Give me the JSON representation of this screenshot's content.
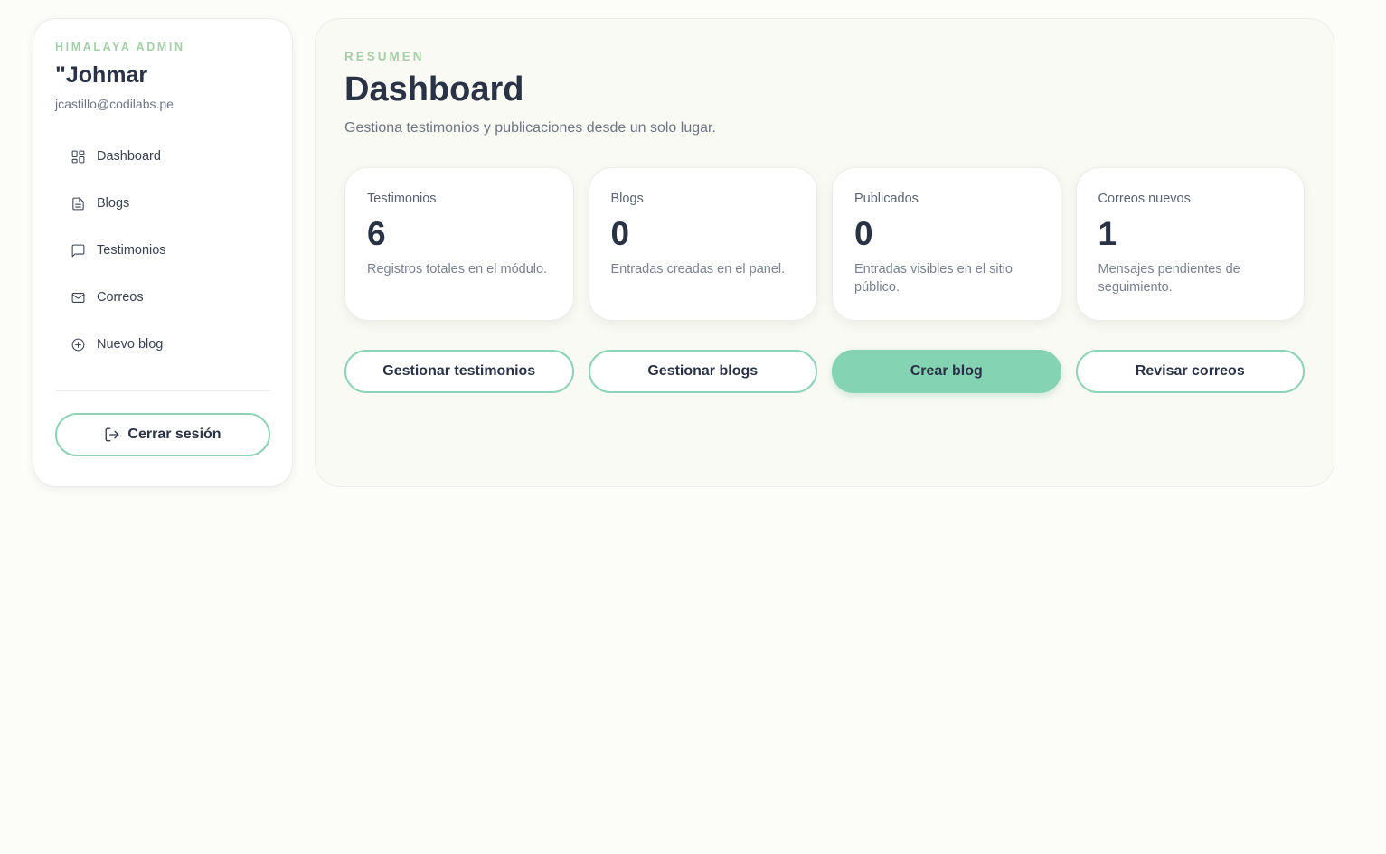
{
  "sidebar": {
    "brand": "HIMALAYA ADMIN",
    "user_name": "\"Johmar",
    "user_email": "jcastillo@codilabs.pe",
    "items": [
      {
        "label": "Dashboard",
        "icon": "dashboard-grid-icon"
      },
      {
        "label": "Blogs",
        "icon": "document-icon"
      },
      {
        "label": "Testimonios",
        "icon": "message-square-icon"
      },
      {
        "label": "Correos",
        "icon": "mail-icon"
      },
      {
        "label": "Nuevo blog",
        "icon": "plus-circle-icon"
      }
    ],
    "logout_label": "Cerrar sesión"
  },
  "main": {
    "eyebrow": "RESUMEN",
    "title": "Dashboard",
    "subtitle": "Gestiona testimonios y publicaciones desde un solo lugar.",
    "stats": [
      {
        "label": "Testimonios",
        "value": "6",
        "desc": "Registros totales en el módulo."
      },
      {
        "label": "Blogs",
        "value": "0",
        "desc": "Entradas creadas en el panel."
      },
      {
        "label": "Publicados",
        "value": "0",
        "desc": "Entradas visibles en el sitio público."
      },
      {
        "label": "Correos nuevos",
        "value": "1",
        "desc": "Mensajes pendientes de seguimiento."
      }
    ],
    "actions": [
      {
        "label": "Gestionar testimonios"
      },
      {
        "label": "Gestionar blogs"
      },
      {
        "label": "Crear blog"
      },
      {
        "label": "Revisar correos"
      }
    ]
  },
  "colors": {
    "accent": "#84d3b2",
    "brand_label": "#a5cfa9",
    "text_dark": "#2a3246",
    "page_bg": "#fcfcf9"
  }
}
